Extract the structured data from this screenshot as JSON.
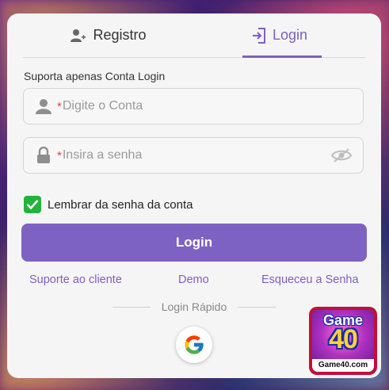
{
  "tabs": {
    "register_label": "Registro",
    "login_label": "Login"
  },
  "form": {
    "subtitle": "Suporta apenas Conta Login",
    "account_placeholder": "Digite o Conta",
    "password_placeholder": "Insira a senha",
    "required_mark": "*",
    "remember_label": "Lembrar da senha da conta",
    "remember_checked": true,
    "login_button": "Login"
  },
  "links": {
    "support": "Suporte ao cliente",
    "demo": "Demo",
    "forgot": "Esqueceu a Senha"
  },
  "quick_login": {
    "label": "Login Rápido",
    "provider_icon": "google-icon"
  },
  "brand": {
    "logo_text_game": "Game",
    "logo_text_number": "40",
    "logo_footer": "Game40.com"
  },
  "colors": {
    "accent": "#7e62c3",
    "checkbox": "#22b43a",
    "required": "#e0404a"
  }
}
